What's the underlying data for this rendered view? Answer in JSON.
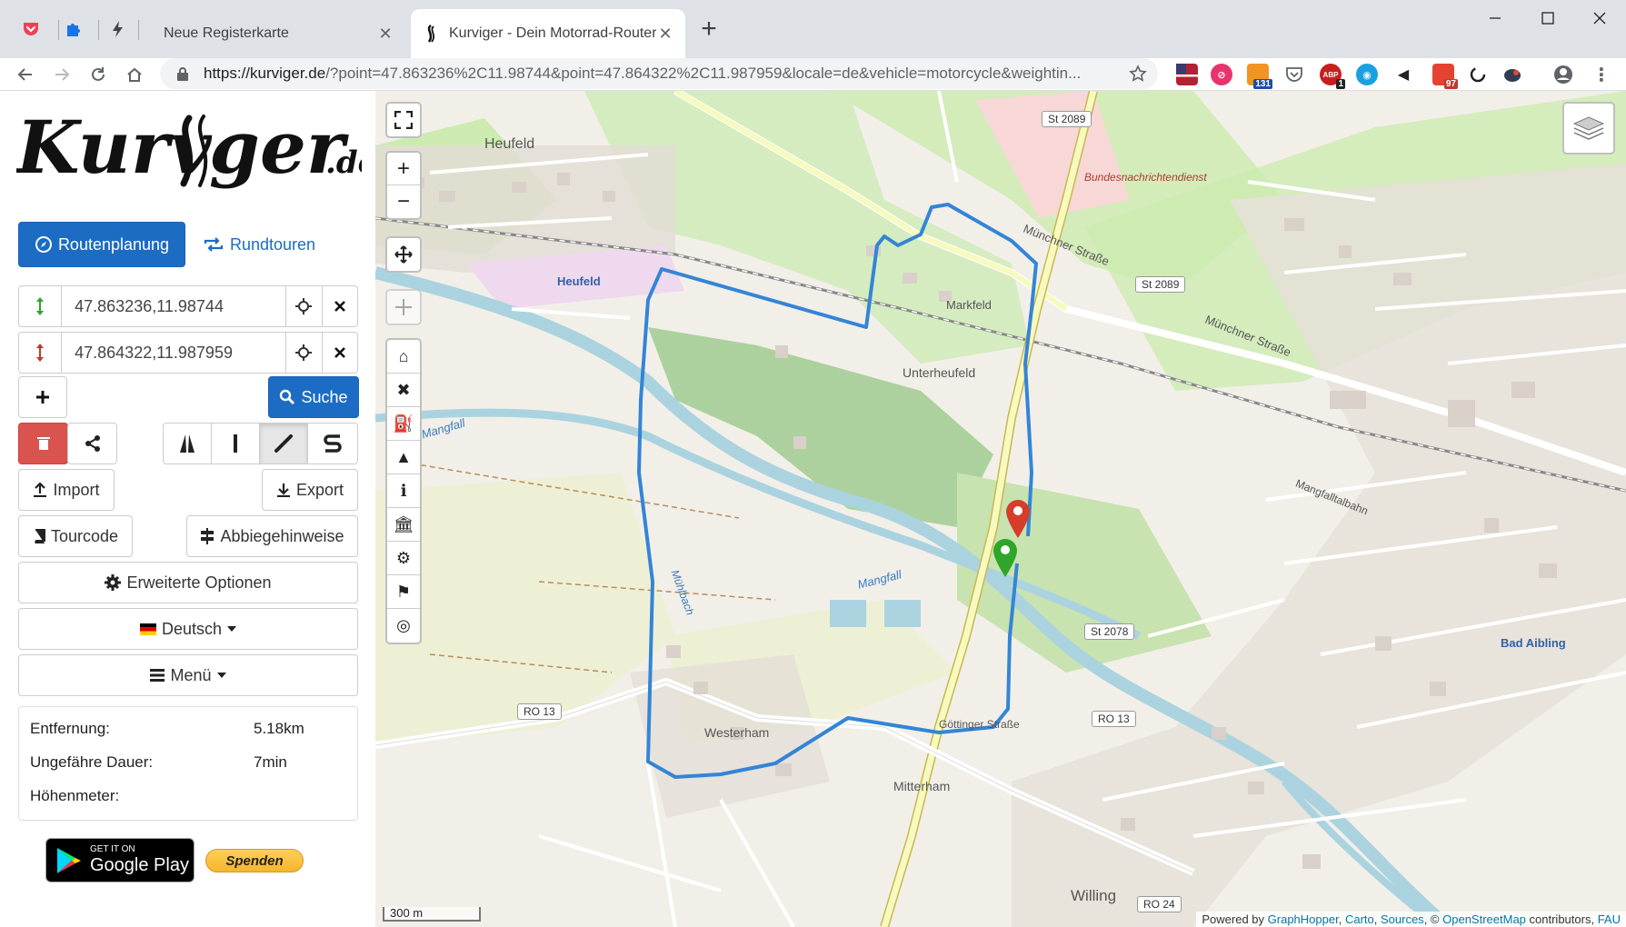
{
  "browser": {
    "tabs": [
      {
        "title": "Neue Registerkarte",
        "close": "✕"
      },
      {
        "title": "Kurviger - Dein Motorrad-Router",
        "close": "✕"
      }
    ],
    "new_tab": "+",
    "url_host": "https://kurviger.de",
    "url_rest": "/?point=47.863236%2C11.98744&point=47.864322%2C11.987959&locale=de&vehicle=motorcycle&weightin...",
    "extension_badges": {
      "mail": "131",
      "abp": "1",
      "todoist": "97"
    }
  },
  "sidebar": {
    "logo_main": "Kurviger",
    "logo_suffix": ".de",
    "mode_tabs": {
      "routing": "Routenplanung",
      "roundtrip": "Rundtouren"
    },
    "waypoints": [
      {
        "value": "47.863236,11.98744",
        "color": "#2ca52c"
      },
      {
        "value": "47.864322,11.987959",
        "color": "#c0392b"
      }
    ],
    "search_label": "Suche",
    "import_label": "Import",
    "export_label": "Export",
    "tourcode_label": "Tourcode",
    "turn_label": "Abbiegehinweise",
    "options_label": "Erweiterte Optionen",
    "language_label": "Deutsch",
    "menu_label": "Menü",
    "stats": {
      "distance_label": "Entfernung:",
      "distance_value": "5.18km",
      "duration_label": "Ungefähre Dauer:",
      "duration_value": "7min",
      "elevation_label": "Höhenmeter:",
      "elevation_value": ""
    },
    "gplay_small": "GET IT ON",
    "gplay_big": "Google Play",
    "donate_label": "Spenden"
  },
  "map": {
    "labels": {
      "heufeld_top": "Heufeld",
      "heufeld_mid": "Heufeld",
      "markfeld": "Markfeld",
      "unterheufeld": "Unterheufeld",
      "westerham": "Westerham",
      "mitterham": "Mitterham",
      "willing": "Willing",
      "bad_aibling": "Bad Aibling",
      "bnd": "Bundesnachrichtendienst",
      "mangfall1": "Mangfall",
      "mangfall2": "Mangfall",
      "muenchner1": "Münchner Straße",
      "muenchner2": "Münchner Straße",
      "mangfalltalbahn": "Mangfalltalbahn",
      "goettinger": "Göttinger Straße",
      "muhlbach": "Mühlbach"
    },
    "shields": [
      "St 2089",
      "St 2089",
      "St 2078",
      "RO 13",
      "RO 13",
      "RO 24"
    ],
    "scale": "300 m",
    "attribution": {
      "prefix": "Powered by",
      "links": [
        "GraphHopper",
        "Carto",
        "Sources"
      ],
      "copy": ", ©",
      "osm": "OpenStreetMap",
      "suffix": "contributors,",
      "fau": "FAU"
    },
    "route_color": "#3385d6"
  }
}
